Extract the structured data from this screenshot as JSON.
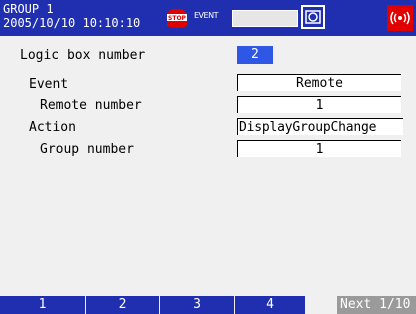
{
  "header": {
    "group": "GROUP 1",
    "datetime": "2005/10/10 10:10:10",
    "stop_icon": "stop-icon",
    "event_label": "EVENT",
    "camera_icon": "camera-icon",
    "alarm_icon": "alarm-icon",
    "colors": {
      "bar": "#1f2fb0",
      "alarm": "#e00000",
      "selected": "#2e57e6"
    }
  },
  "settings": {
    "logic_box": {
      "label": "Logic box number",
      "value": "2"
    },
    "event": {
      "label": "Event",
      "value": "Remote"
    },
    "remote_number": {
      "label": "Remote number",
      "value": "1"
    },
    "action": {
      "label": "Action",
      "value": "DisplayGroupChange"
    },
    "group_number": {
      "label": "Group number",
      "value": "1"
    }
  },
  "softkeys": {
    "keys": [
      "1",
      "2",
      "3",
      "4"
    ],
    "next": "Next 1/10"
  }
}
